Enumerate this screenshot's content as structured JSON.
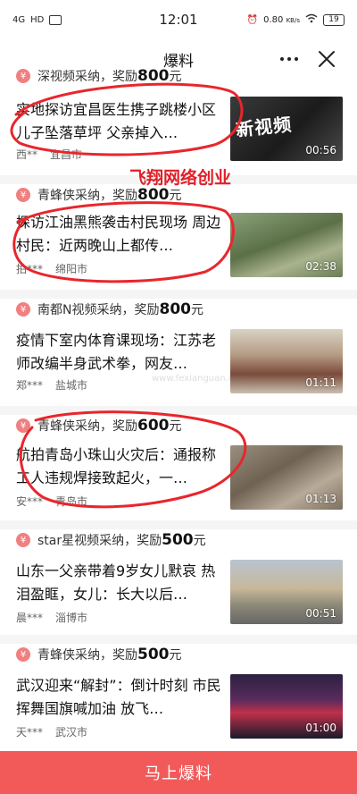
{
  "status": {
    "carrier": "4G",
    "hd": "HD",
    "time": "12:01",
    "speed": "0.80",
    "speed_unit": "KB/s",
    "battery": "19"
  },
  "nav": {
    "title": "爆料",
    "more_icon": "more-dots-icon",
    "close_icon": "close-icon"
  },
  "watermark": "飞翔网络创业",
  "faint_watermark": "www.fexianguan.com",
  "feed": [
    {
      "source_prefix": "深视频采纳，奖励",
      "reward": "800",
      "reward_unit": "元",
      "title": "实地探访宜昌医生携子跳楼小区 儿子坠落草坪 父亲掉入…",
      "author": "西**",
      "city": "宜昌市",
      "thumb_text": "新视频",
      "duration": "00:56"
    },
    {
      "source_prefix": "青蜂侠采纳，奖励",
      "reward": "800",
      "reward_unit": "元",
      "title": "探访江油黑熊袭击村民现场 周边村民：近两晚山上都传…",
      "author": "拍***",
      "city": "绵阳市",
      "duration": "02:38"
    },
    {
      "source_prefix": "南都N视频采纳，奖励",
      "reward": "800",
      "reward_unit": "元",
      "title": "疫情下室内体育课现场：江苏老师改编半身武术拳，网友…",
      "author": "郑***",
      "city": "盐城市",
      "duration": "01:11"
    },
    {
      "source_prefix": "青蜂侠采纳，奖励",
      "reward": "600",
      "reward_unit": "元",
      "title": "航拍青岛小珠山火灾后：通报称工人违规焊接致起火，一…",
      "author": "安***",
      "city": "青岛市",
      "duration": "01:13"
    },
    {
      "source_prefix": "star星视频采纳，奖励",
      "reward": "500",
      "reward_unit": "元",
      "title": "山东一父亲带着9岁女儿默哀 热泪盈眶，女儿：长大以后…",
      "author": "晨***",
      "city": "淄博市",
      "duration": "00:51"
    },
    {
      "source_prefix": "青蜂侠采纳，奖励",
      "reward": "500",
      "reward_unit": "元",
      "title": "武汉迎来“解封”：倒计时刻 市民挥舞国旗喊加油 放飞…",
      "author": "天***",
      "city": "武汉市",
      "duration": "01:00"
    }
  ],
  "cta_label": "马上爆料",
  "colors": {
    "accent": "#f25a5a",
    "yen_badge": "#f08080",
    "watermark": "#e0202a",
    "annotation": "#e8262c"
  }
}
